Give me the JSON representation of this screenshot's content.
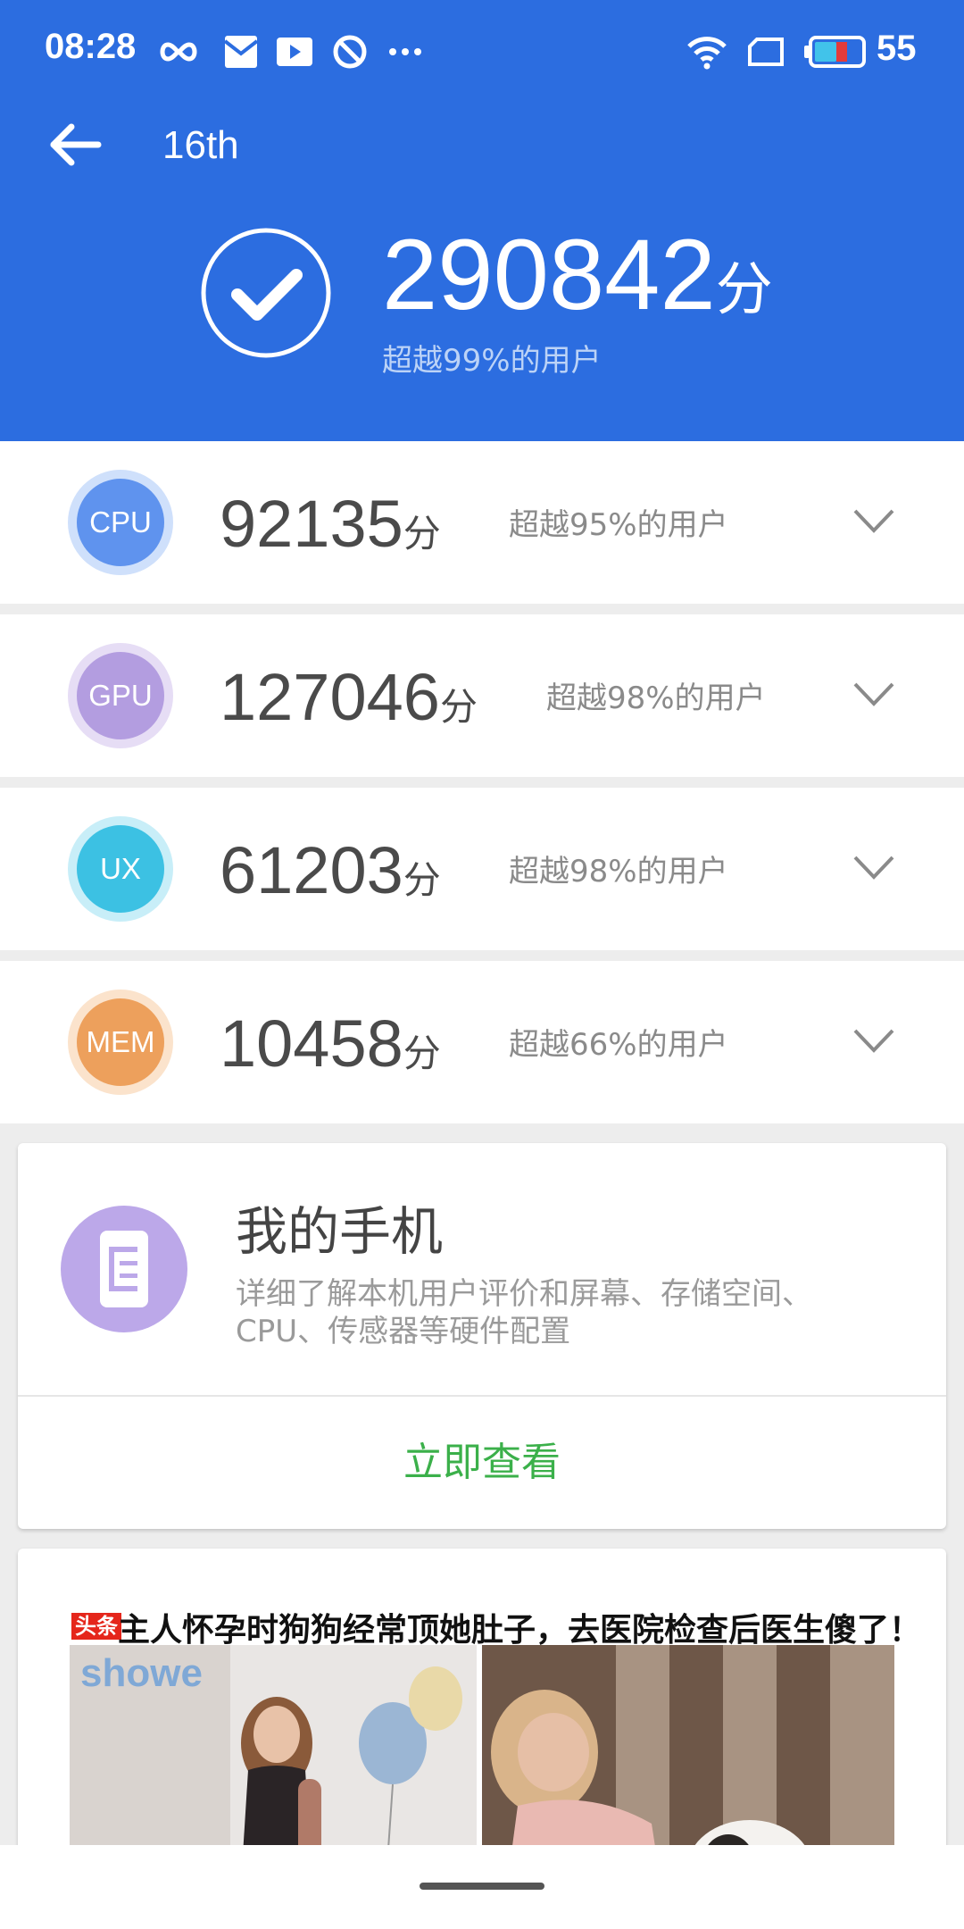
{
  "status_bar": {
    "time": "08:28",
    "battery_percent": "55",
    "icons": [
      "infinity-icon",
      "mail-icon",
      "play-icon",
      "block-icon",
      "more-dots-icon",
      "wifi-icon",
      "screen-icon",
      "battery-icon"
    ]
  },
  "header": {
    "title": "16th",
    "total_score": "290842",
    "score_unit": "分",
    "rank_text": "超越99%的用户"
  },
  "scores": [
    {
      "label": "CPU",
      "score": "92135",
      "unit": "分",
      "rank": "超越95%的用户",
      "color": "#5f93ee",
      "ring": "#cfe0fb"
    },
    {
      "label": "GPU",
      "score": "127046",
      "unit": "分",
      "rank": "超越98%的用户",
      "color": "#b39de0",
      "ring": "#e6ddf5"
    },
    {
      "label": "UX",
      "score": "61203",
      "unit": "分",
      "rank": "超越98%的用户",
      "color": "#3cc1e3",
      "ring": "#c8eef8"
    },
    {
      "label": "MEM",
      "score": "10458",
      "unit": "分",
      "rank": "超越66%的用户",
      "color": "#eda05c",
      "ring": "#fbe3cc"
    }
  ],
  "my_phone": {
    "title": "我的手机",
    "description": "详细了解本机用户评价和屏幕、存储空间、CPU、传感器等硬件配置",
    "action": "立即查看",
    "action_color": "#3bb04a"
  },
  "ad": {
    "source": "头条",
    "title": "主人怀孕时狗狗经常顶她肚子，去医院检查后医生傻了！",
    "balloon_text": "showe"
  },
  "colors": {
    "header_blue": "#2c6de0",
    "background": "#ededed"
  }
}
